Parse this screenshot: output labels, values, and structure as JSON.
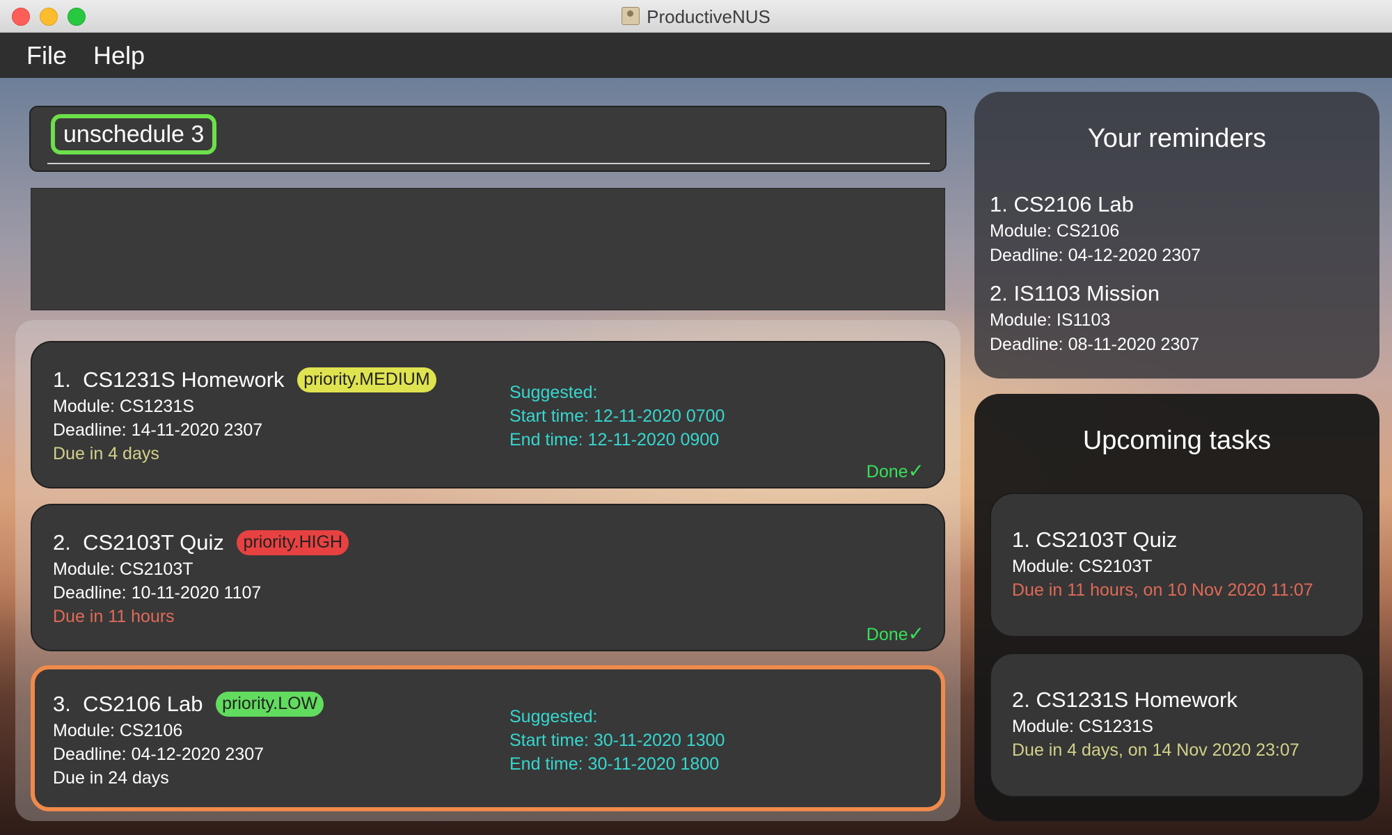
{
  "window": {
    "title": "ProductiveNUS"
  },
  "menu": {
    "items": [
      "File",
      "Help"
    ]
  },
  "command": {
    "value": "unschedule 3"
  },
  "result": {
    "text": ""
  },
  "tasks": [
    {
      "index": "1.",
      "name": "CS1231S Homework",
      "priority": "priority.MEDIUM",
      "module": "Module: CS1231S",
      "deadline": "Deadline: 14-11-2020 2307",
      "due": "Due in 4 days",
      "suggested_label": "Suggested:",
      "start": "Start time: 12-11-2020 0700",
      "end": "End time: 12-11-2020 0900",
      "done": "Done",
      "done_icon": "✓"
    },
    {
      "index": "2.",
      "name": "CS2103T Quiz",
      "priority": "priority.HIGH",
      "module": "Module: CS2103T",
      "deadline": "Deadline: 10-11-2020 1107",
      "due": "Due in 11 hours",
      "done": "Done",
      "done_icon": "✓"
    },
    {
      "index": "3.",
      "name": "CS2106 Lab",
      "priority": "priority.LOW",
      "module": "Module: CS2106",
      "deadline": "Deadline: 04-12-2020 2307",
      "due": "Due in 24 days",
      "suggested_label": "Suggested:",
      "start": "Start time: 30-11-2020 1300",
      "end": "End time: 30-11-2020 1800"
    }
  ],
  "reminders": {
    "title": "Your reminders",
    "items": [
      {
        "heading": "1.  CS2106 Lab",
        "module": "Module: CS2106",
        "deadline": "Deadline: 04-12-2020 2307"
      },
      {
        "heading": "2.  IS1103 Mission",
        "module": "Module: IS1103",
        "deadline": "Deadline: 08-11-2020 2307"
      }
    ]
  },
  "upcoming": {
    "title": "Upcoming tasks",
    "items": [
      {
        "heading": "1.  CS2103T Quiz",
        "module": "Module: CS2103T",
        "due": "Due in 11 hours, on 10 Nov 2020 11:07"
      },
      {
        "heading": "2.  CS1231S Homework",
        "module": "Module: CS1231S",
        "due": "Due in 4 days, on 14 Nov 2020 23:07"
      }
    ]
  },
  "colors": {
    "selected_border": "#f08a4b",
    "command_highlight": "#6ce04a",
    "suggested_text": "#36d7cf",
    "done_text": "#38e05a",
    "due_yellow": "#d2d18a",
    "due_red": "#e06a57"
  }
}
